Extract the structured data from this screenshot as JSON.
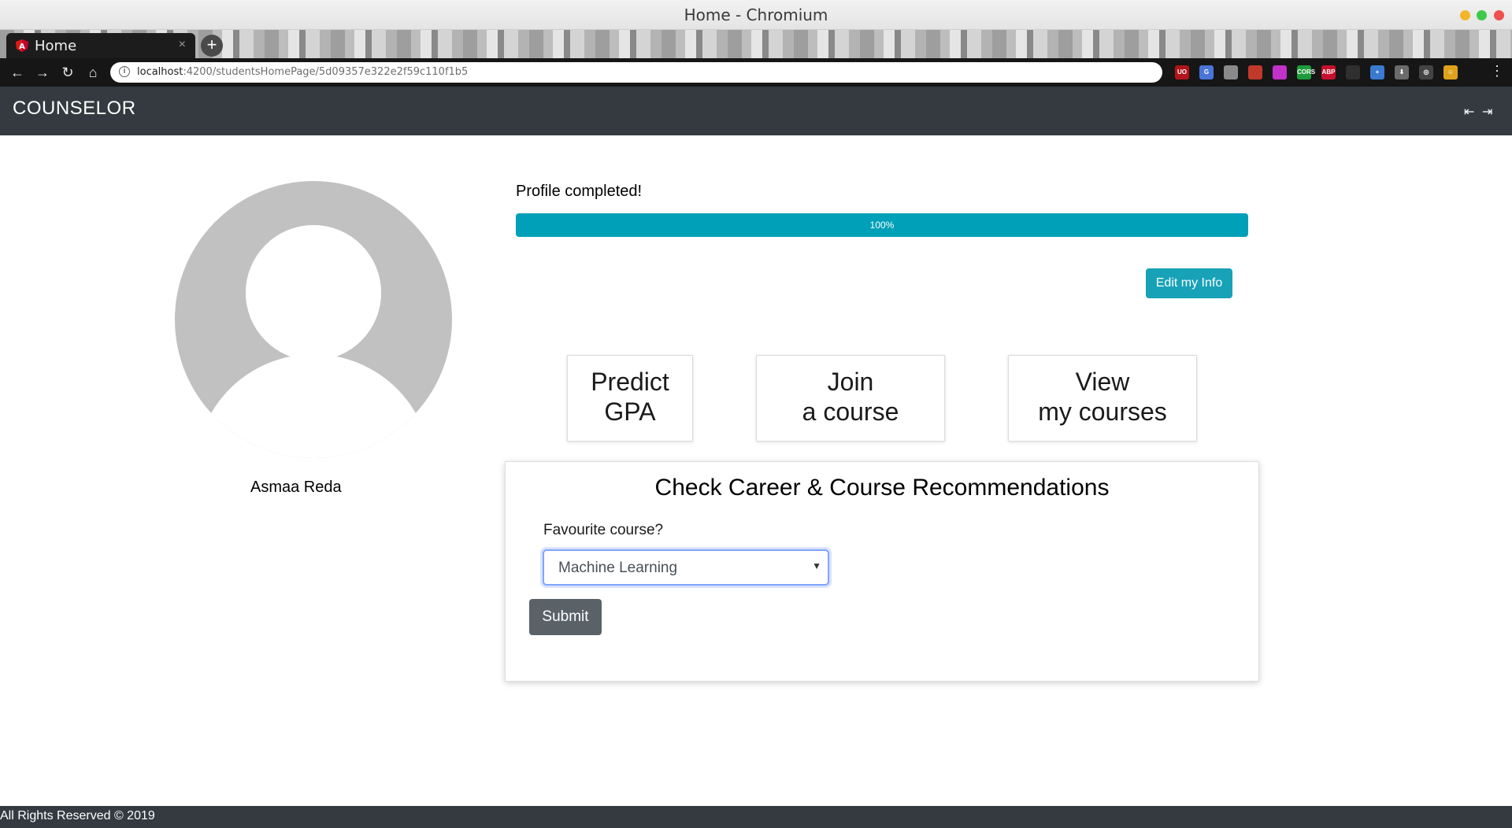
{
  "window": {
    "title": "Home - Chromium",
    "controls": {
      "minimize_color": "#f5b52a",
      "maximize_color": "#3ec94b",
      "close_color": "#ef4f4f"
    }
  },
  "browser": {
    "tab": {
      "label": "Home",
      "favicon": "angular-icon",
      "close_glyph": "×"
    },
    "new_tab_glyph": "+",
    "nav": {
      "back": "←",
      "forward": "→",
      "reload": "↻",
      "home": "⌂"
    },
    "url": {
      "host": "localhost",
      "path": ":4200/studentsHomePage/5d09357e322e2f59c110f1b5"
    },
    "omnibox_icons": {
      "key": "⚷",
      "star": "☆"
    },
    "extensions": [
      {
        "name": "ublock-icon",
        "text": "UO",
        "color": "#b0151b"
      },
      {
        "name": "translate-icon",
        "text": "G",
        "color": "#4a74d8"
      },
      {
        "name": "extension-grey-icon",
        "text": "",
        "color": "#8a8a8a"
      },
      {
        "name": "pen-icon",
        "text": "",
        "color": "#c0392b"
      },
      {
        "name": "face-icon",
        "text": "",
        "color": "#c032c9"
      },
      {
        "name": "cors-icon",
        "text": "CORS",
        "color": "#1d9b3a"
      },
      {
        "name": "abp-icon",
        "text": "ABP",
        "color": "#c8102e"
      },
      {
        "name": "leaf-icon",
        "text": "",
        "color": "#2f2f2f"
      },
      {
        "name": "plus-blue-icon",
        "text": "+",
        "color": "#3a7ad0"
      },
      {
        "name": "download-icon",
        "text": "⬇",
        "color": "#6b6b6b"
      },
      {
        "name": "chrome-icon",
        "text": "◎",
        "color": "#444444"
      },
      {
        "name": "emoji-icon",
        "text": "☺",
        "color": "#e0a21a"
      }
    ],
    "menu_glyph": "⋮"
  },
  "app": {
    "brand": "COUNSELOR",
    "nav_icons": {
      "logout": "⇤",
      "login": "⇥"
    },
    "student_name": "Asmaa Reda",
    "profile": {
      "label": "Profile completed!",
      "progress_value": 100,
      "progress_text": "100%",
      "progress_color": "#00a0b8"
    },
    "edit_button": "Edit my Info",
    "actions": {
      "predict_gpa": {
        "line1": "Predict",
        "line2": "GPA"
      },
      "join_course": {
        "line1": "Join",
        "line2": "a course"
      },
      "view_courses": {
        "line1": "View",
        "line2": "my courses"
      }
    },
    "recommendations": {
      "title": "Check Career & Course Recommendations",
      "favourite_label": "Favourite course?",
      "selected_course": "Machine Learning",
      "submit": "Submit"
    },
    "footer": "All Rights Reserved © 2019"
  }
}
